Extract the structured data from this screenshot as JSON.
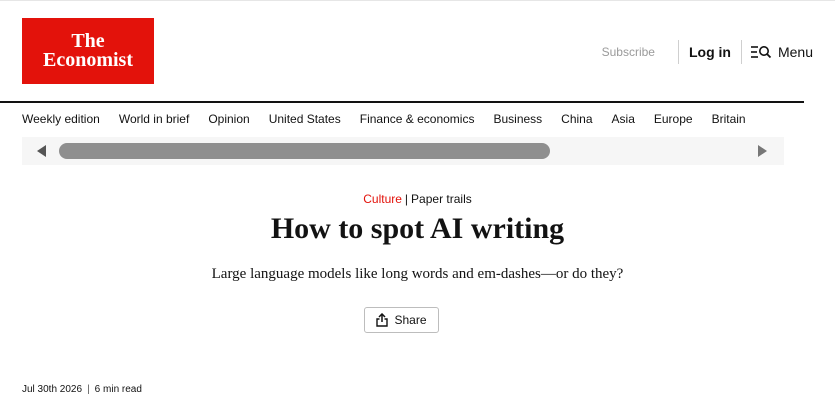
{
  "brand": {
    "logo_line1": "The",
    "logo_line2": "Economist",
    "color": "#e3120b"
  },
  "header": {
    "subscribe_label": "Subscribe",
    "login_label": "Log in",
    "menu_label": "Menu",
    "menu_icon": "menu-search-icon"
  },
  "nav": {
    "items": [
      "Weekly edition",
      "World in brief",
      "Opinion",
      "United States",
      "Finance & economics",
      "Business",
      "China",
      "Asia",
      "Europe",
      "Britain"
    ]
  },
  "article": {
    "section": "Culture",
    "fly_title": "Paper trails",
    "headline": "How to spot AI writing",
    "subheadline": "Large language models like long words and em-dashes—or do they?",
    "share_label": "Share",
    "share_icon": "share-icon",
    "date": "Jul 30th 2026",
    "read_time": "6 min read"
  }
}
